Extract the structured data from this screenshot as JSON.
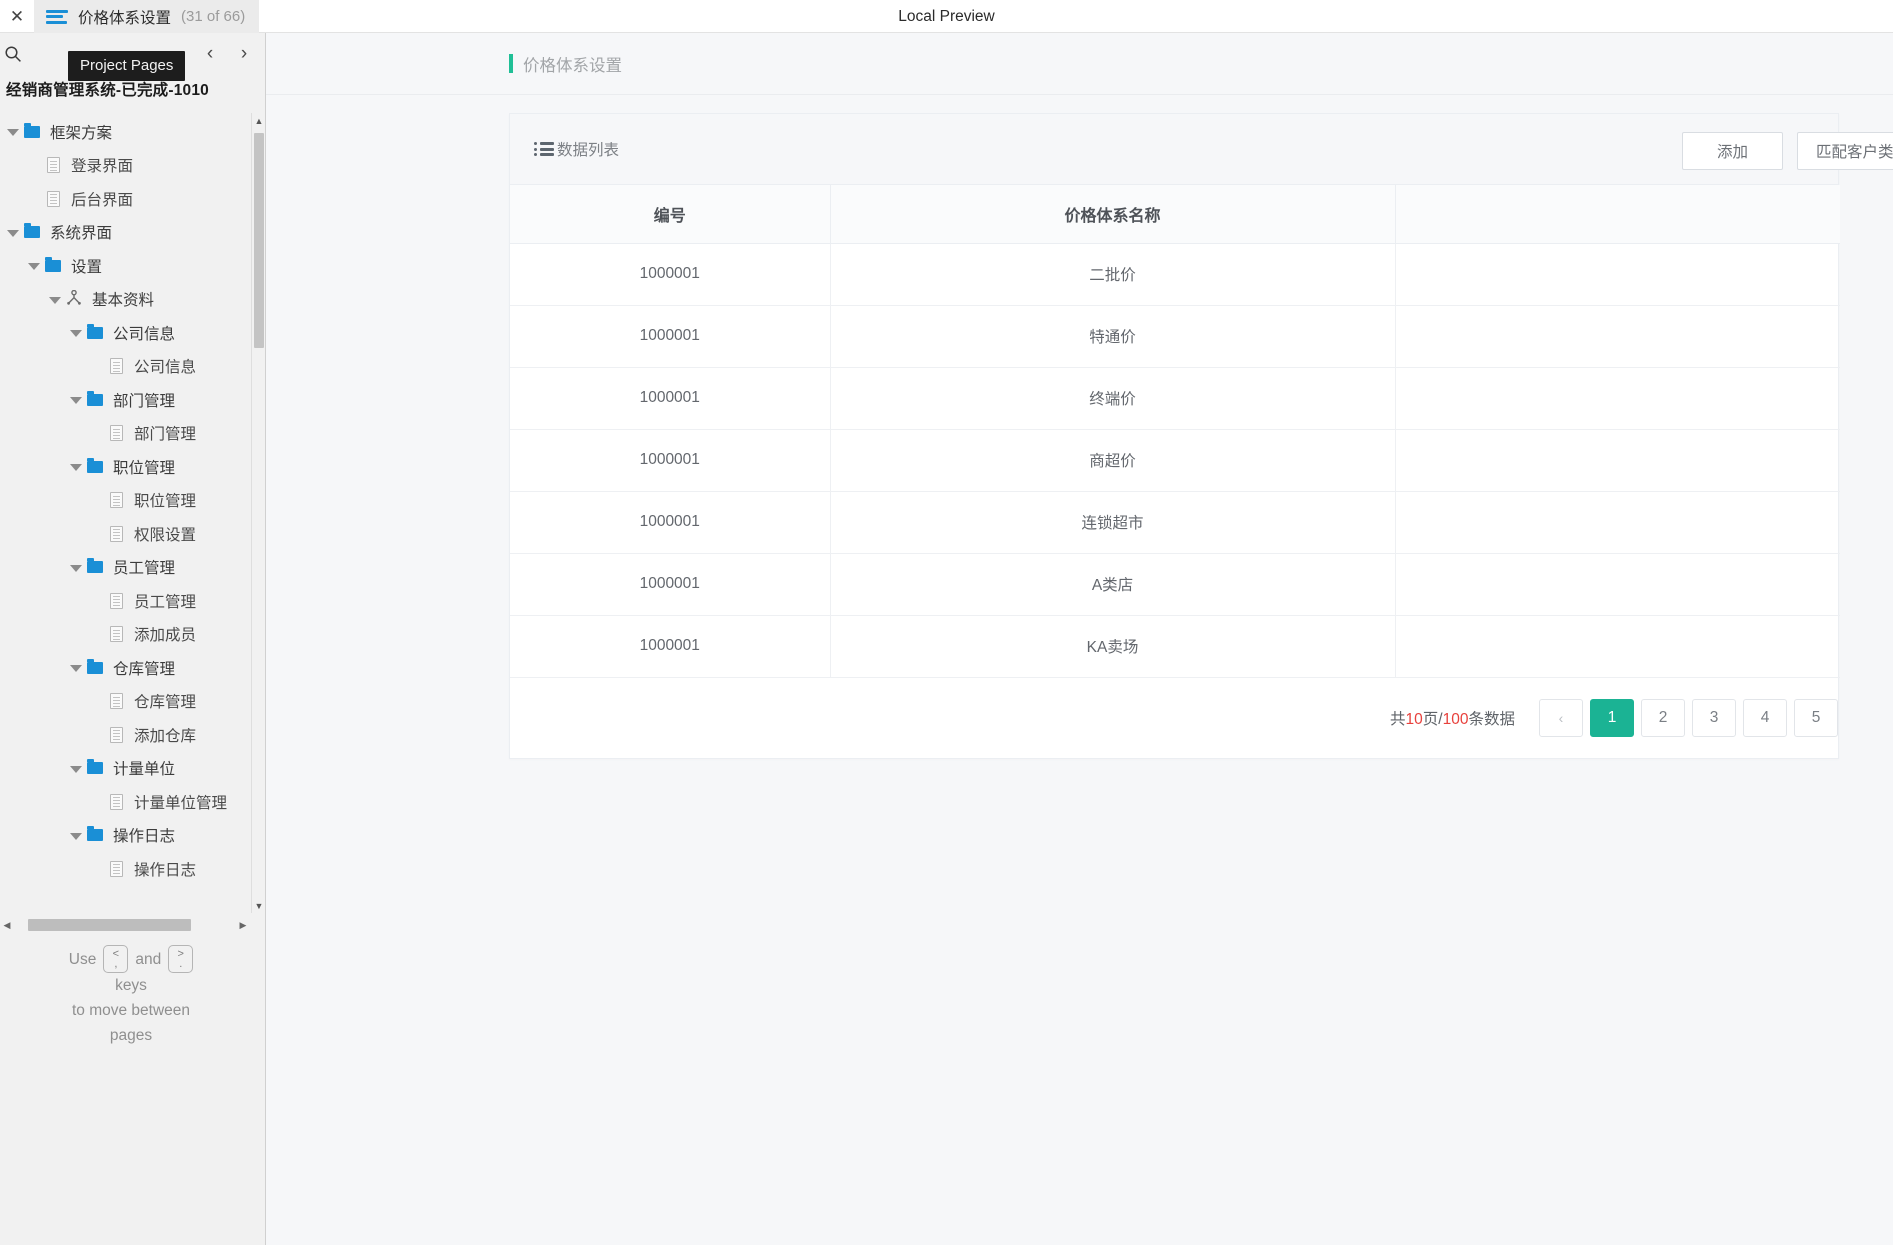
{
  "topbar": {
    "close_label": "✕",
    "tab_title": "价格体系设置",
    "tab_count": "(31 of 66)",
    "preview_label": "Local Preview",
    "menu_icon": "hamburger-icon"
  },
  "sidebar": {
    "tooltip": "Project Pages",
    "search_icon": "search-icon",
    "prev_arrow": "‹",
    "next_arrow": "›",
    "project_title": "经销商管理系统-已完成-1010",
    "tree": [
      {
        "label": "框架方案",
        "type": "folder",
        "depth": 0,
        "expanded": true
      },
      {
        "label": "登录界面",
        "type": "page",
        "depth": 1
      },
      {
        "label": "后台界面",
        "type": "page",
        "depth": 1
      },
      {
        "label": "系统界面",
        "type": "folder",
        "depth": 0,
        "expanded": true
      },
      {
        "label": "设置",
        "type": "folder",
        "depth": 1,
        "expanded": true
      },
      {
        "label": "基本资料",
        "type": "master",
        "depth": 2,
        "expanded": true
      },
      {
        "label": "公司信息",
        "type": "folder",
        "depth": 3,
        "expanded": true
      },
      {
        "label": "公司信息",
        "type": "page",
        "depth": 4
      },
      {
        "label": "部门管理",
        "type": "folder",
        "depth": 3,
        "expanded": true
      },
      {
        "label": "部门管理",
        "type": "page",
        "depth": 4
      },
      {
        "label": "职位管理",
        "type": "folder",
        "depth": 3,
        "expanded": true
      },
      {
        "label": "职位管理",
        "type": "page",
        "depth": 4
      },
      {
        "label": "权限设置",
        "type": "page",
        "depth": 4
      },
      {
        "label": "员工管理",
        "type": "folder",
        "depth": 3,
        "expanded": true
      },
      {
        "label": "员工管理",
        "type": "page",
        "depth": 4
      },
      {
        "label": "添加成员",
        "type": "page",
        "depth": 4
      },
      {
        "label": "仓库管理",
        "type": "folder",
        "depth": 3,
        "expanded": true
      },
      {
        "label": "仓库管理",
        "type": "page",
        "depth": 4
      },
      {
        "label": "添加仓库",
        "type": "page",
        "depth": 4
      },
      {
        "label": "计量单位",
        "type": "folder",
        "depth": 3,
        "expanded": true
      },
      {
        "label": "计量单位管理",
        "type": "page",
        "depth": 4
      },
      {
        "label": "操作日志",
        "type": "folder",
        "depth": 3,
        "expanded": true
      },
      {
        "label": "操作日志",
        "type": "page",
        "depth": 4
      }
    ],
    "help": {
      "use": "Use",
      "and": "and",
      "key_prev_top": "<",
      "key_prev_bottom": ",",
      "key_next_top": ">",
      "key_next_bottom": ".",
      "line2": "keys",
      "line3": "to move between",
      "line4": "pages"
    }
  },
  "main": {
    "page_title": "价格体系设置",
    "accent_color": "#1fbf96",
    "card": {
      "header_icon": "list-icon",
      "header_title": "数据列表",
      "buttons": [
        {
          "label": "添加",
          "name": "add-button"
        },
        {
          "label": "匹配客户类型",
          "name": "match-customer-type-button"
        }
      ],
      "table": {
        "columns": [
          "编号",
          "价格体系名称",
          ""
        ],
        "rows": [
          {
            "id": "1000001",
            "name": "二批价",
            "extra": ""
          },
          {
            "id": "1000001",
            "name": "特通价",
            "extra": ""
          },
          {
            "id": "1000001",
            "name": "终端价",
            "extra": ""
          },
          {
            "id": "1000001",
            "name": "商超价",
            "extra": ""
          },
          {
            "id": "1000001",
            "name": "连锁超市",
            "extra": ""
          },
          {
            "id": "1000001",
            "name": "A类店",
            "extra": ""
          },
          {
            "id": "1000001",
            "name": "KA卖场",
            "extra": ""
          }
        ]
      },
      "pagination": {
        "summary_prefix": "共",
        "total_pages": "10",
        "summary_mid": "页/",
        "total_records": "100",
        "summary_suffix": "条数据",
        "prev": "‹",
        "pages": [
          "1",
          "2",
          "3",
          "4",
          "5"
        ],
        "active_page": "1",
        "active_color": "#1bb394"
      }
    }
  }
}
